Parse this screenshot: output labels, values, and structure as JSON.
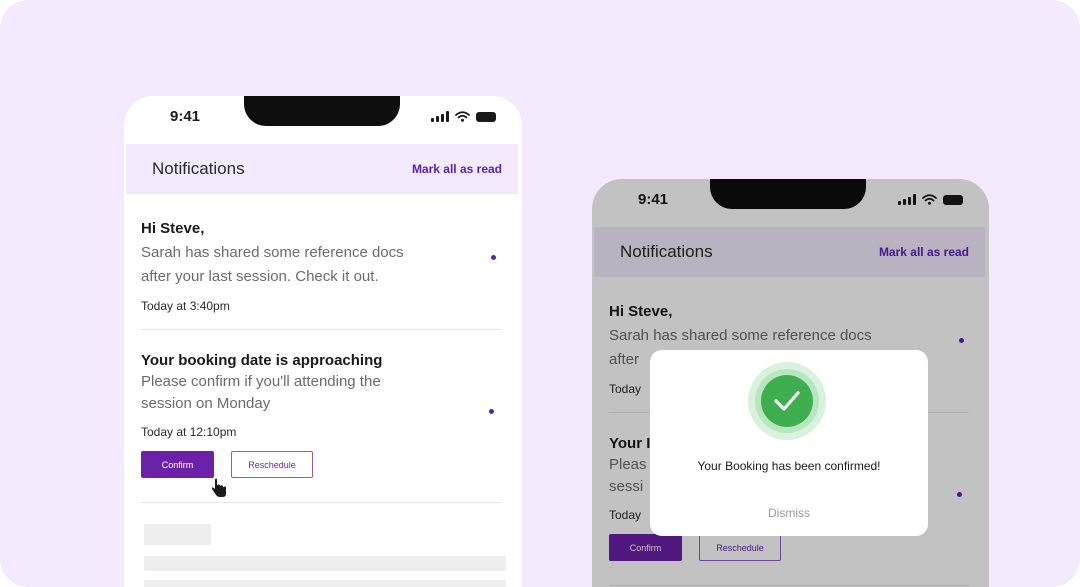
{
  "colors": {
    "background": "#f3eafd",
    "accent": "#6b21a8",
    "unread_dot": "#5b21b6",
    "success": "#3fae4f"
  },
  "status_bar": {
    "time": "9:41",
    "icons": [
      "signal-icon",
      "wifi-icon",
      "battery-icon"
    ]
  },
  "header": {
    "title": "Notifications",
    "mark_all_label": "Mark all as read"
  },
  "notifications": [
    {
      "heading": "Hi Steve,",
      "body_line1": "Sarah has shared some reference docs",
      "body_line2": "after your last session. Check it out.",
      "time": "Today at 3:40pm",
      "unread": true
    },
    {
      "heading": "Your booking date is approaching",
      "body_line1": "Please confirm if you'll attending the",
      "body_line2": "session on Monday",
      "time": "Today at 12:10pm",
      "unread": true,
      "actions": {
        "confirm_label": "Confirm",
        "reschedule_label": "Reschedule"
      }
    }
  ],
  "second_phone": {
    "body_line2_partial": "after",
    "time_partial": "Today",
    "heading_partial": "Your I",
    "body_partial_1": "Pleas",
    "body_partial_2": "sessi"
  },
  "modal": {
    "message": "Your Booking has been confirmed!",
    "dismiss_label": "Dismiss",
    "icon": "check-circle-icon"
  }
}
